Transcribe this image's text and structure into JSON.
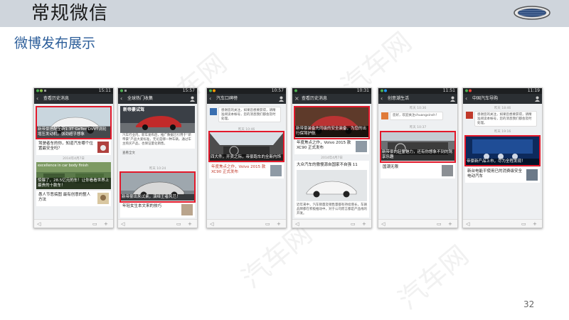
{
  "slide": {
    "title": "常规微信",
    "subtitle": "微博发布展示",
    "page_number": "32",
    "watermark": "汽车网"
  },
  "colors": {
    "header_bg": "#cfd5dc",
    "subtitle": "#2c5e9a",
    "highlight": "#e3192b",
    "phone_nav": "#2b2f33"
  },
  "phones": [
    {
      "time": "15:11",
      "nav_title": "查看历史消息",
      "lead_caption": "新带豪搭配全新1.3T GeTec DVVT涡轮增压发动机，强劲超乎想象",
      "row1": "驾驶者车的你，知道汽车哪个位置最安全吗？",
      "timestamp": "2014年4月7日",
      "second_img_text": "excellence in car body finish",
      "second_caption": "惊爆了，28.5亿元的车！让你看看世界上最贵的十款车！",
      "row2": "愚人节恶搞图 最有创意的整人方法"
    },
    {
      "time": "15:57",
      "nav_title": "全球热门收集",
      "top_label": "新帝豪试驾",
      "text_block": "汽车行业内，新车发布后，推广数据已引用于“新帝豪”产品大爱标准，无论是哪一种车辆，通过车主购买产品，也保证量化销售。",
      "text_sub": "查看全文",
      "timestamp": "昨天 10:24",
      "highlight_caption": "新帝豪出来试乘，演绎王者风范！",
      "row1": "年轻女生本文来的技巧"
    },
    {
      "time": "10:57",
      "nav_title": "汽车口碑榜",
      "msg_text": "感谢您的关注，如果您想要获得，请精准阅读本帐号，您的消息我们都会及时处理。",
      "timestamp": "昨天 10:46",
      "highlight_caption": "四大件，开卖之际，帝豪跑车的全新内饰",
      "row1": "年度焦点之作，Volvo 2015 款 XC90 正式发布"
    },
    {
      "time": "10:31",
      "nav_title": "查看历史消息",
      "highlight_caption": "新带豪装备先同级的安全装备，为您的出行保驾护航",
      "row1": "年度焦点之作，Volvo 2015 款 XC90 正式发布",
      "timestamp": "2014年4月7日",
      "row2": "大众汽车的傲慢源自国家不自强 11",
      "body_text": "近年来中，汽车销量及销售量都有持续增长，车辆品牌都在积极推动中，对于公司而言都是产品线的开发。"
    },
    {
      "time": "11:51",
      "nav_title": "创意潮生活",
      "timestamp": "昨天 10:36",
      "welcome": "您好，欢迎关注chuangxinsh！",
      "msg_time": "昨天 10:37",
      "highlight_caption": "新带豪的轻奢魅力，还有你想象不到的驾享乐趣",
      "row1": "国潮无限"
    },
    {
      "time": "11:19",
      "nav_title": "中国汽车导购",
      "ts1": "昨天 18:46",
      "msg_text": "感谢您的关注，如果您想要获得，请精准阅读本帐号，您的消息我们都会及时处理。",
      "ts2": "昨天 19:16",
      "highlight_caption": "帝豪新产品上市，尽为全程发现！",
      "row1": "新台电能平使用已的消费级安全电动汽车"
    }
  ]
}
